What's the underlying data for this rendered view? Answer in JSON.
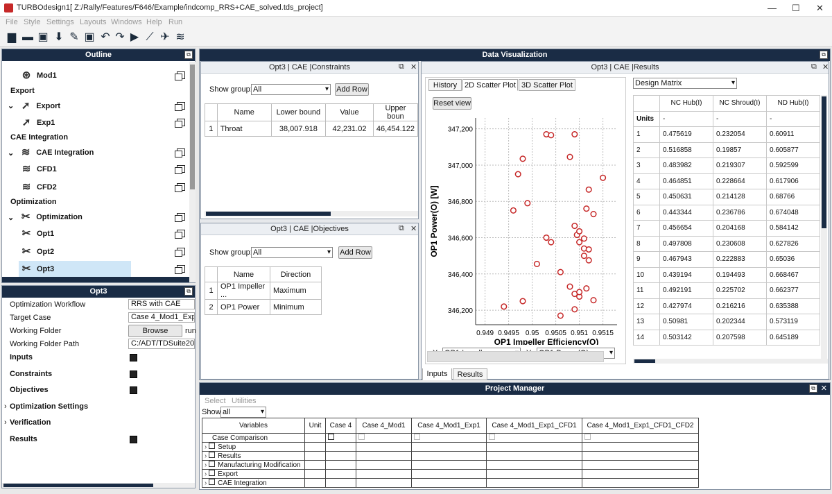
{
  "window": {
    "title": "TURBOdesign1[ Z:/Rally/Features/F646/Example/indcomp_RRS+CAE_solved.tds_project]",
    "min": "—",
    "max": "☐",
    "close": "✕"
  },
  "menu": [
    "File",
    "Style",
    "Settings",
    "Layouts",
    "Windows",
    "Help",
    "Run"
  ],
  "outline": {
    "title": "Outline",
    "rows": [
      {
        "type": "item",
        "label": "Mod1",
        "icon": "rotor-icon"
      },
      {
        "type": "cat",
        "label": "Export"
      },
      {
        "type": "group",
        "label": "Export",
        "icon": "export-arrow-icon"
      },
      {
        "type": "item",
        "label": "Exp1",
        "icon": "export-arrow-icon"
      },
      {
        "type": "cat",
        "label": "CAE Integration"
      },
      {
        "type": "group",
        "label": "CAE Integration",
        "icon": "cae-icon"
      },
      {
        "type": "item",
        "label": "CFD1",
        "icon": "cae-icon"
      },
      {
        "type": "item",
        "label": "CFD2",
        "icon": "cae-icon"
      },
      {
        "type": "cat",
        "label": "Optimization"
      },
      {
        "type": "group",
        "label": "Optimization",
        "icon": "optimization-icon"
      },
      {
        "type": "item",
        "label": "Opt1",
        "icon": "optimization-icon"
      },
      {
        "type": "item",
        "label": "Opt2",
        "icon": "optimization-icon"
      },
      {
        "type": "item",
        "label": "Opt3",
        "icon": "optimization-icon",
        "selected": true
      }
    ]
  },
  "opt3panel": {
    "title": "Opt3",
    "rows": [
      {
        "label": "Optimization Workflow",
        "value": "RRS with CAE"
      },
      {
        "label": "Target Case",
        "value": "Case 4_Mod1_Exp1_C"
      },
      {
        "label": "Working Folder",
        "button": "Browse",
        "extra": "run"
      },
      {
        "label": "Working Folder Path",
        "value": "C:/ADT/TDSuite2024_1"
      }
    ],
    "sections": [
      {
        "label": "Inputs",
        "icon": true,
        "arrow": false
      },
      {
        "label": "Constraints",
        "icon": true,
        "arrow": false
      },
      {
        "label": "Objectives",
        "icon": true,
        "arrow": false
      },
      {
        "label": "Optimization Settings",
        "icon": false,
        "arrow": true
      },
      {
        "label": "Verification",
        "icon": false,
        "arrow": true
      },
      {
        "label": "Results",
        "icon": true,
        "arrow": false
      }
    ]
  },
  "dataviz": {
    "title": "Data Visualization"
  },
  "constraints": {
    "title": "Opt3 | CAE |Constraints",
    "show_group_label": "Show group:",
    "group": "All",
    "add_row": "Add Row",
    "headers": [
      "Name",
      "Lower bound",
      "Value",
      "Upper boun"
    ],
    "rows": [
      [
        "1",
        "Throat",
        "38,007.918",
        "42,231.02",
        "46,454.122"
      ]
    ]
  },
  "objectives": {
    "title": "Opt3 | CAE |Objectives",
    "show_group_label": "Show group:",
    "group": "All",
    "add_row": "Add Row",
    "headers": [
      "Name",
      "Direction"
    ],
    "rows": [
      [
        "1",
        "OP1 Impeller ...",
        "Maximum"
      ],
      [
        "2",
        "OP1 Power",
        "Minimum"
      ]
    ]
  },
  "results": {
    "title": "Opt3 | CAE |Results",
    "tabs": [
      "History",
      "2D Scatter Plot",
      "3D Scatter Plot"
    ],
    "reset": "Reset view",
    "x_label": "X :",
    "x_select": "OP1 Impeller Efficiency",
    "y_label": "Y :",
    "y_select": "OP1 Power(O)",
    "bottom_tabs": [
      "Inputs",
      "Results"
    ],
    "design_matrix": {
      "select": "Design Matrix",
      "headers": [
        "NC Hub(I)",
        "NC Shroud(I)",
        "ND Hub(I)"
      ],
      "units_label": "Units",
      "units": [
        "-",
        "-",
        "-"
      ],
      "rows": [
        [
          "1",
          "0.475619",
          "0.232054",
          "0.60911"
        ],
        [
          "2",
          "0.516858",
          "0.19857",
          "0.605877"
        ],
        [
          "3",
          "0.483982",
          "0.219307",
          "0.592599"
        ],
        [
          "4",
          "0.464851",
          "0.228664",
          "0.617906"
        ],
        [
          "5",
          "0.450631",
          "0.214128",
          "0.68766"
        ],
        [
          "6",
          "0.443344",
          "0.236786",
          "0.674048"
        ],
        [
          "7",
          "0.456654",
          "0.204168",
          "0.584142"
        ],
        [
          "8",
          "0.497808",
          "0.230608",
          "0.627826"
        ],
        [
          "9",
          "0.467943",
          "0.222883",
          "0.65036"
        ],
        [
          "10",
          "0.439194",
          "0.194493",
          "0.668467"
        ],
        [
          "11",
          "0.492191",
          "0.225702",
          "0.662377"
        ],
        [
          "12",
          "0.427974",
          "0.216216",
          "0.635388"
        ],
        [
          "13",
          "0.50981",
          "0.202344",
          "0.573119"
        ],
        [
          "14",
          "0.503142",
          "0.207598",
          "0.645189"
        ]
      ]
    }
  },
  "chart_data": {
    "type": "scatter",
    "xlabel": "OP1 Impeller Efficiency(O)",
    "ylabel": "OP1 Power(O) [W]",
    "xlim": [
      0.9488,
      0.9518
    ],
    "ylim": [
      346120,
      347260
    ],
    "xticks": [
      0.949,
      0.9495,
      0.95,
      0.9505,
      0.951,
      0.9515
    ],
    "xtick_labels": [
      "0.949",
      "0.9495",
      "0.95",
      "0.9505",
      "0.951",
      "0.9515"
    ],
    "yticks": [
      346200,
      346400,
      346600,
      346800,
      347000,
      347200
    ],
    "ytick_labels": [
      "346,200",
      "346,400",
      "346,600",
      "346,800",
      "347,000",
      "347,200"
    ],
    "points": [
      [
        0.9494,
        346220
      ],
      [
        0.9496,
        346750
      ],
      [
        0.9497,
        346950
      ],
      [
        0.9498,
        347035
      ],
      [
        0.9498,
        346250
      ],
      [
        0.9499,
        346790
      ],
      [
        0.9501,
        346455
      ],
      [
        0.9503,
        347170
      ],
      [
        0.9503,
        346600
      ],
      [
        0.9504,
        346575
      ],
      [
        0.9504,
        347165
      ],
      [
        0.9506,
        346410
      ],
      [
        0.9506,
        346170
      ],
      [
        0.9508,
        346330
      ],
      [
        0.9508,
        347045
      ],
      [
        0.9509,
        346665
      ],
      [
        0.9509,
        347170
      ],
      [
        0.9509,
        346205
      ],
      [
        0.9509,
        346290
      ],
      [
        0.95095,
        346615
      ],
      [
        0.951,
        346275
      ],
      [
        0.951,
        346635
      ],
      [
        0.951,
        346575
      ],
      [
        0.951,
        346300
      ],
      [
        0.9511,
        346595
      ],
      [
        0.9511,
        346540
      ],
      [
        0.9511,
        346500
      ],
      [
        0.95115,
        346320
      ],
      [
        0.95115,
        346760
      ],
      [
        0.9512,
        346865
      ],
      [
        0.9512,
        346475
      ],
      [
        0.9512,
        346535
      ],
      [
        0.9513,
        346255
      ],
      [
        0.9513,
        346730
      ],
      [
        0.9515,
        346930
      ]
    ],
    "marker_color": "#c62828",
    "grid": true
  },
  "project_manager": {
    "title": "Project Manager",
    "menu": [
      "Select",
      "Utilities"
    ],
    "show_label": "Show:",
    "show": "all",
    "headers": [
      "Variables",
      "Unit",
      "Case 4",
      "Case 4_Mod1",
      "Case 4_Mod1_Exp1",
      "Case 4_Mod1_Exp1_CFD1",
      "Case 4_Mod1_Exp1_CFD1_CFD2"
    ],
    "rows": [
      "Case Comparison",
      "Setup",
      "Results",
      "Manufacturing Modification",
      "Export",
      "CAE Integration"
    ]
  }
}
